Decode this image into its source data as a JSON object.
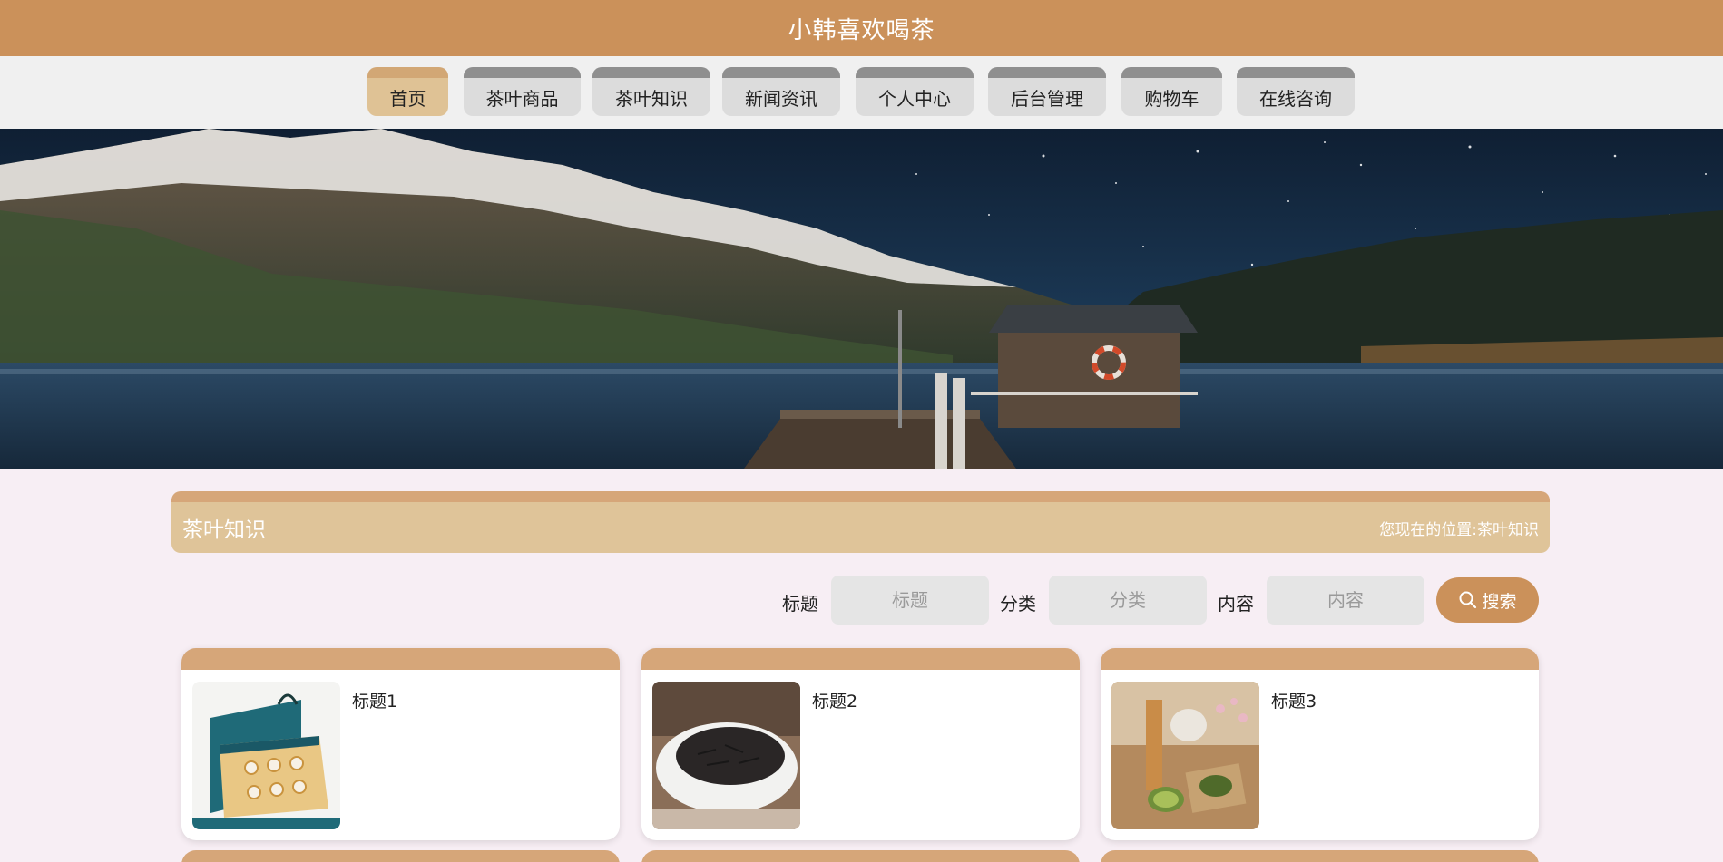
{
  "header": {
    "site_title": "小韩喜欢喝茶"
  },
  "nav": {
    "items": [
      {
        "label": "首页",
        "active": true
      },
      {
        "label": "茶叶商品",
        "active": false
      },
      {
        "label": "茶叶知识",
        "active": false
      },
      {
        "label": "新闻资讯",
        "active": false
      },
      {
        "label": "个人中心",
        "active": false
      },
      {
        "label": "后台管理",
        "active": false
      },
      {
        "label": "购物车",
        "active": false
      },
      {
        "label": "在线咨询",
        "active": false
      }
    ]
  },
  "section": {
    "title": "茶叶知识",
    "breadcrumb_prefix": "您现在的位置:",
    "breadcrumb_current": "茶叶知识"
  },
  "search": {
    "fields": [
      {
        "label": "标题",
        "placeholder": "标题",
        "value": ""
      },
      {
        "label": "分类",
        "placeholder": "分类",
        "value": ""
      },
      {
        "label": "内容",
        "placeholder": "内容",
        "value": ""
      }
    ],
    "button_label": "搜索",
    "button_icon": "search-icon"
  },
  "cards": [
    {
      "title": "标题1",
      "image": "tea-gift-box"
    },
    {
      "title": "标题2",
      "image": "black-tea-leaves-bowl"
    },
    {
      "title": "标题3",
      "image": "tea-set-table"
    }
  ],
  "colors": {
    "brand": "#cb915a",
    "nav_active": "#dfc295",
    "section_band": "#dfc499",
    "page_background": "#f7eef4"
  }
}
